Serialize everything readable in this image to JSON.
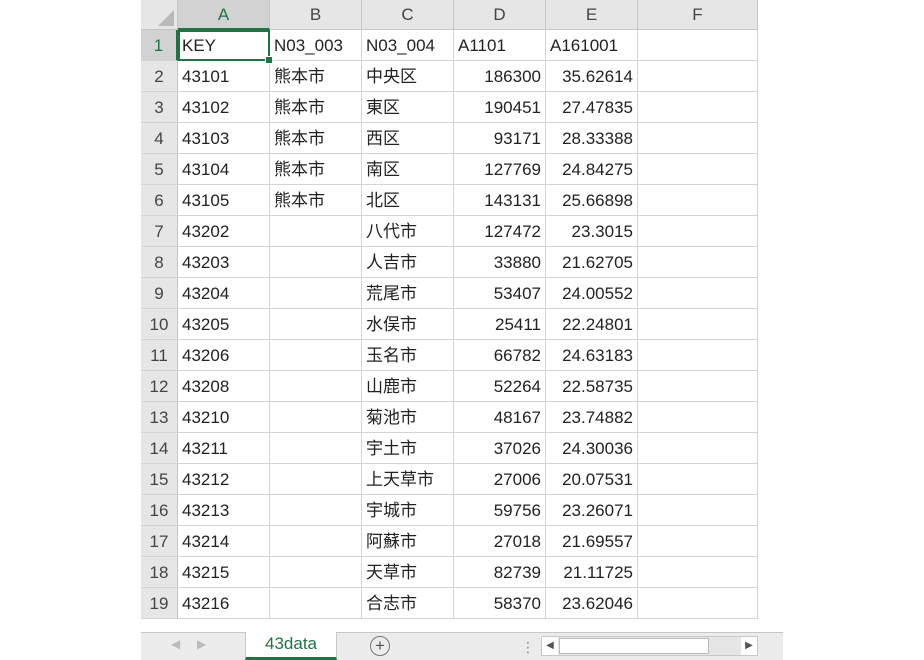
{
  "columns": [
    "A",
    "B",
    "C",
    "D",
    "E",
    "F"
  ],
  "rows": [
    {
      "n": "1",
      "cells": [
        "KEY",
        "N03_003",
        "N03_004",
        "A1101",
        "A161001",
        ""
      ]
    },
    {
      "n": "2",
      "cells": [
        "43101",
        "熊本市",
        "中央区",
        "186300",
        "35.62614",
        ""
      ]
    },
    {
      "n": "3",
      "cells": [
        "43102",
        "熊本市",
        "東区",
        "190451",
        "27.47835",
        ""
      ]
    },
    {
      "n": "4",
      "cells": [
        "43103",
        "熊本市",
        "西区",
        "93171",
        "28.33388",
        ""
      ]
    },
    {
      "n": "5",
      "cells": [
        "43104",
        "熊本市",
        "南区",
        "127769",
        "24.84275",
        ""
      ]
    },
    {
      "n": "6",
      "cells": [
        "43105",
        "熊本市",
        "北区",
        "143131",
        "25.66898",
        ""
      ]
    },
    {
      "n": "7",
      "cells": [
        "43202",
        "",
        "八代市",
        "127472",
        "23.3015",
        ""
      ]
    },
    {
      "n": "8",
      "cells": [
        "43203",
        "",
        "人吉市",
        "33880",
        "21.62705",
        ""
      ]
    },
    {
      "n": "9",
      "cells": [
        "43204",
        "",
        "荒尾市",
        "53407",
        "24.00552",
        ""
      ]
    },
    {
      "n": "10",
      "cells": [
        "43205",
        "",
        "水俣市",
        "25411",
        "22.24801",
        ""
      ]
    },
    {
      "n": "11",
      "cells": [
        "43206",
        "",
        "玉名市",
        "66782",
        "24.63183",
        ""
      ]
    },
    {
      "n": "12",
      "cells": [
        "43208",
        "",
        "山鹿市",
        "52264",
        "22.58735",
        ""
      ]
    },
    {
      "n": "13",
      "cells": [
        "43210",
        "",
        "菊池市",
        "48167",
        "23.74882",
        ""
      ]
    },
    {
      "n": "14",
      "cells": [
        "43211",
        "",
        "宇土市",
        "37026",
        "24.30036",
        ""
      ]
    },
    {
      "n": "15",
      "cells": [
        "43212",
        "",
        "上天草市",
        "27006",
        "20.07531",
        ""
      ]
    },
    {
      "n": "16",
      "cells": [
        "43213",
        "",
        "宇城市",
        "59756",
        "23.26071",
        ""
      ]
    },
    {
      "n": "17",
      "cells": [
        "43214",
        "",
        "阿蘇市",
        "27018",
        "21.69557",
        ""
      ]
    },
    {
      "n": "18",
      "cells": [
        "43215",
        "",
        "天草市",
        "82739",
        "21.11725",
        ""
      ]
    },
    {
      "n": "19",
      "cells": [
        "43216",
        "",
        "合志市",
        "58370",
        "23.62046",
        ""
      ]
    }
  ],
  "active_cell": "A1",
  "sheet_tab": "43data",
  "add_sheet_icon": "plus-circle-icon",
  "accent_color": "#217346",
  "vertical_scroll_position": 0
}
